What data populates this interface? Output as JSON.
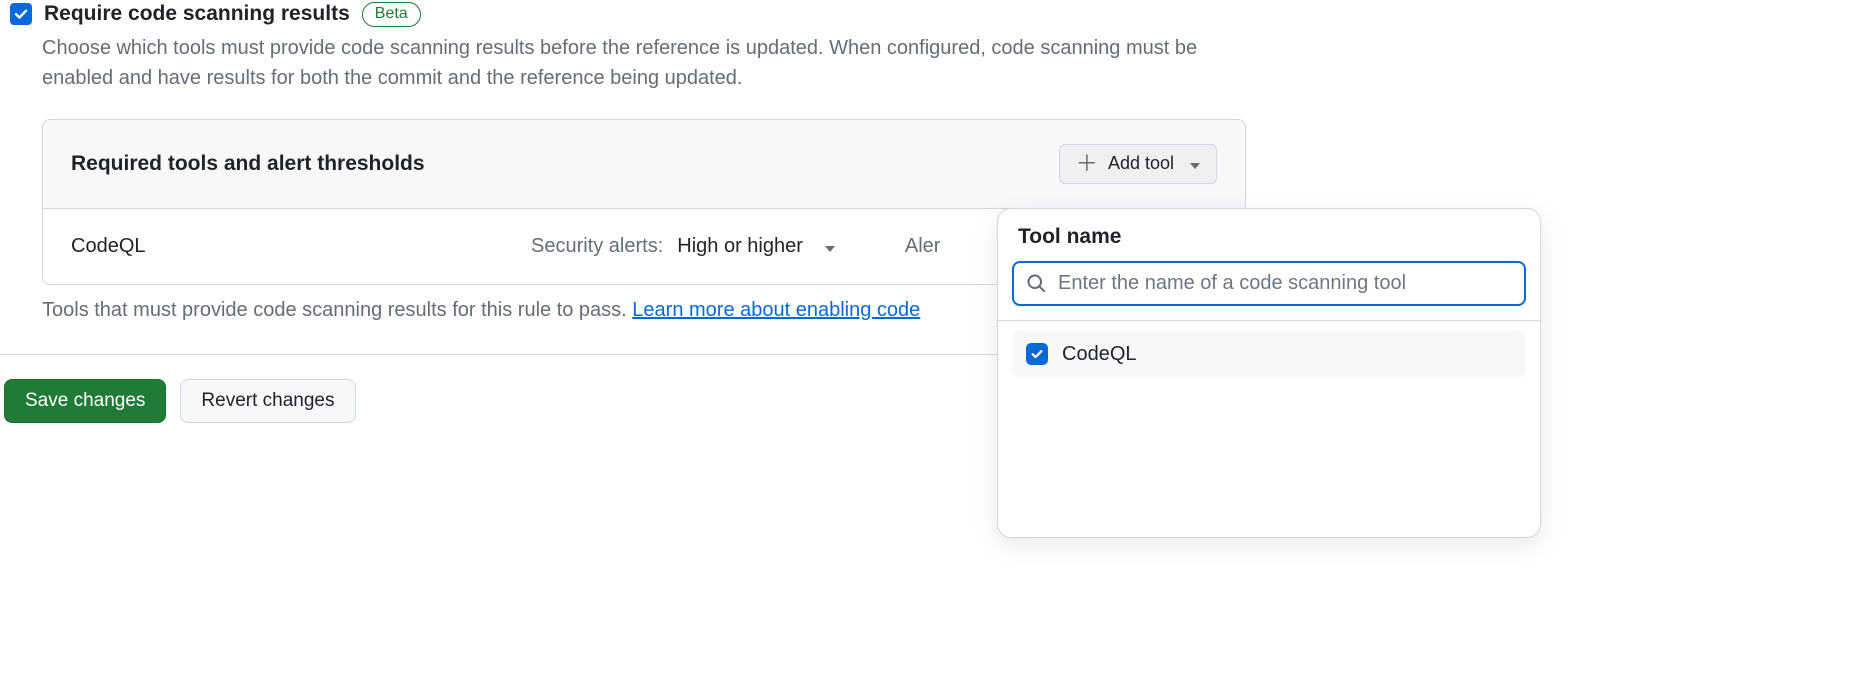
{
  "header": {
    "title": "Require code scanning results",
    "badge": "Beta",
    "description": "Choose which tools must provide code scanning results before the reference is updated. When configured, code scanning must be enabled and have results for both the commit and the reference being updated."
  },
  "panel": {
    "title": "Required tools and alert thresholds",
    "add_tool_label": "Add tool",
    "row": {
      "tool_name": "CodeQL",
      "security_alerts_label": "Security alerts:",
      "security_alerts_value": "High or higher",
      "alerts_truncated": "Aler"
    }
  },
  "helper": {
    "text": "Tools that must provide code scanning results for this rule to pass. ",
    "link": "Learn more about enabling code "
  },
  "actions": {
    "save": "Save changes",
    "revert": "Revert changes"
  },
  "popover": {
    "title": "Tool name",
    "placeholder": "Enter the name of a code scanning tool",
    "options": [
      {
        "label": "CodeQL",
        "checked": true
      }
    ]
  }
}
